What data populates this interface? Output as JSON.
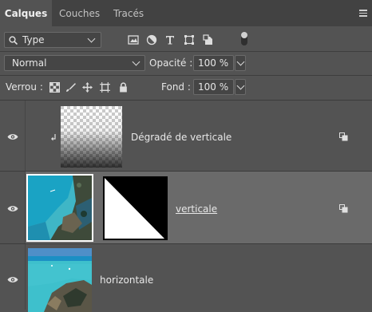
{
  "tabs": [
    {
      "label": "Calques",
      "active": true
    },
    {
      "label": "Couches",
      "active": false
    },
    {
      "label": "Tracés",
      "active": false
    }
  ],
  "filter": {
    "kind_label": "Type",
    "icons": [
      "image-filter-icon",
      "adjustment-filter-icon",
      "text-filter-icon",
      "shape-filter-icon",
      "smart-object-filter-icon"
    ]
  },
  "blend": {
    "mode": "Normal",
    "opacity_label": "Opacité :",
    "opacity_value": "100 %"
  },
  "lock": {
    "label": "Verrou :",
    "icons": [
      "lock-transparency-icon",
      "lock-pixels-icon",
      "lock-position-icon",
      "lock-artboard-icon",
      "lock-all-icon"
    ],
    "fill_label": "Fond :",
    "fill_value": "100 %"
  },
  "layers": [
    {
      "name": "Dégradé de verticale",
      "visible": true,
      "clipped": true,
      "selected": false
    },
    {
      "name": "verticale",
      "visible": true,
      "clipped": false,
      "selected": true,
      "has_mask": true
    },
    {
      "name": "horizontale",
      "visible": true,
      "clipped": false,
      "selected": false
    }
  ],
  "colors": {
    "panel": "#535353",
    "tabbar": "#424242",
    "selected_row": "#6a6a6a"
  }
}
